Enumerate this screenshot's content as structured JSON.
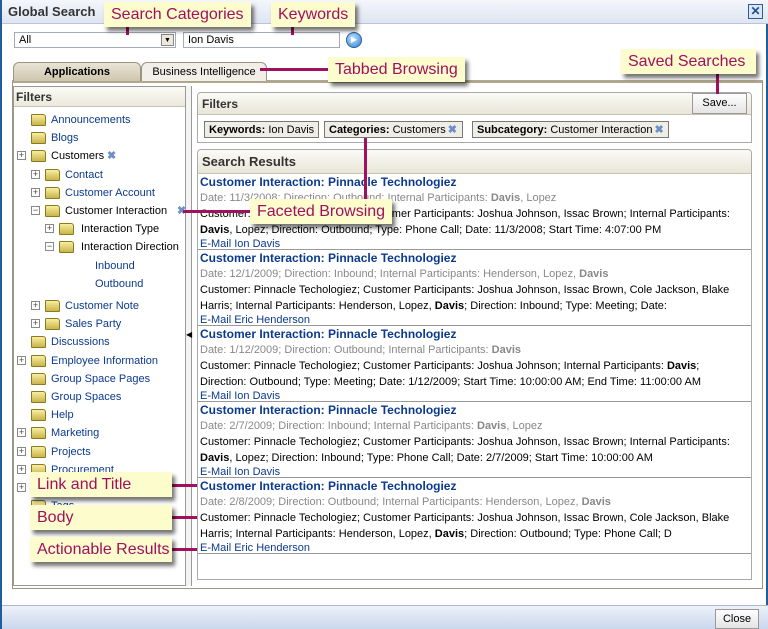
{
  "window": {
    "title": "Global Search",
    "close_icon": "close-icon"
  },
  "search": {
    "category": "All",
    "keywords": "Ion Davis",
    "go_icon": "go-arrow-icon"
  },
  "tabs": [
    {
      "label": "Applications",
      "selected": true
    },
    {
      "label": "Business Intelligence",
      "selected": false
    }
  ],
  "left_panel": {
    "title": "Filters",
    "tree": [
      {
        "label": "Announcements",
        "level": 0,
        "expander": "none",
        "link": true
      },
      {
        "label": "Blogs",
        "level": 0,
        "expander": "none",
        "link": true
      },
      {
        "label": "Customers",
        "level": 0,
        "expander": "plus",
        "link": false,
        "removable": true
      },
      {
        "label": "Contact",
        "level": 1,
        "expander": "plus",
        "link": true
      },
      {
        "label": "Customer Account",
        "level": 1,
        "expander": "plus",
        "link": true
      },
      {
        "label": "Customer Interaction",
        "level": 1,
        "expander": "minus",
        "link": false,
        "open": true,
        "removable": true
      },
      {
        "label": "Interaction Type",
        "level": 2,
        "expander": "plus",
        "link": false
      },
      {
        "label": "Interaction Direction",
        "level": 2,
        "expander": "minus",
        "link": false,
        "open": true
      },
      {
        "label": "Inbound",
        "level": 3,
        "expander": "leaf",
        "link": true
      },
      {
        "label": "Outbound",
        "level": 3,
        "expander": "leaf",
        "link": true
      },
      {
        "label": "Customer Note",
        "level": 1,
        "expander": "plus",
        "link": true,
        "gap": true
      },
      {
        "label": "Sales Party",
        "level": 1,
        "expander": "plus",
        "link": true
      },
      {
        "label": "Discussions",
        "level": 0,
        "expander": "none",
        "link": true
      },
      {
        "label": "Employee Information",
        "level": 0,
        "expander": "plus",
        "link": true
      },
      {
        "label": "Group Space Pages",
        "level": 0,
        "expander": "none",
        "link": true
      },
      {
        "label": "Group Spaces",
        "level": 0,
        "expander": "none",
        "link": true
      },
      {
        "label": "Help",
        "level": 0,
        "expander": "none",
        "link": true
      },
      {
        "label": "Marketing",
        "level": 0,
        "expander": "plus",
        "link": true
      },
      {
        "label": "Projects",
        "level": 0,
        "expander": "plus",
        "link": true
      },
      {
        "label": "Procurement",
        "level": 0,
        "expander": "plus",
        "link": true
      },
      {
        "label": "",
        "level": 0,
        "expander": "plus",
        "link": true
      },
      {
        "label": "Tags",
        "level": 0,
        "expander": "none",
        "link": true
      }
    ]
  },
  "filters": {
    "title": "Filters",
    "save_label": "Save...",
    "chips": [
      {
        "key": "Keywords:",
        "value": "Ion Davis",
        "removable": false
      },
      {
        "key": "Categories:",
        "value": "Customers",
        "removable": true
      },
      {
        "key": "Subcategory:",
        "value": "Customer Interaction",
        "removable": true
      }
    ]
  },
  "results": {
    "title": "Search Results",
    "items": [
      {
        "title": "Customer Interaction: Pinnacle Technologiez",
        "meta": [
          {
            "t": "Date: 11/3/2008; Direction: Outbound; Internal Participants: "
          },
          {
            "t": "Davis",
            "b": true
          },
          {
            "t": ", Lopez"
          }
        ],
        "body": [
          {
            "t": "Customer: Pinnacle Techologiez; Customer Participants: Joshua Johnson, Issac Brown; Internal Participants: "
          },
          {
            "t": "Davis",
            "b": true
          },
          {
            "t": ", Lopez; Direction: Outbound; Type: Phone Call; Date: 11/3/2008; Start Time: 4:07:00 PM"
          }
        ],
        "action": "E-Mail Ion Davis"
      },
      {
        "title": "Customer Interaction: Pinnacle Technologiez",
        "meta": [
          {
            "t": "Date: 12/1/2009; Direction: Inbound; Internal Participants: Henderson, Lopez, "
          },
          {
            "t": "Davis",
            "b": true
          }
        ],
        "body": [
          {
            "t": "Customer: Pinnacle Techologiez; Customer Participants: Joshua Johnson, Issac Brown, Cole Jackson, Blake Harris; Internal Participants: Henderson, Lopez, "
          },
          {
            "t": "Davis",
            "b": true
          },
          {
            "t": "; Direction: Inbound; Type: Meeting; Date:"
          }
        ],
        "action": "E-Mail Eric Henderson"
      },
      {
        "title": "Customer Interaction: Pinnacle Technologiez",
        "meta": [
          {
            "t": "Date: 1/12/2009; Direction: Outbound; Internal Participants: "
          },
          {
            "t": "Davis",
            "b": true
          }
        ],
        "body": [
          {
            "t": "Customer: Pinnacle Techologiez; Customer Participants: Joshua Johnson; Internal Participants: "
          },
          {
            "t": "Davis",
            "b": true
          },
          {
            "t": "; Direction: Outbound; Type: Meeting; Date: 1/12/2009; Start Time: 10:00:00 AM; End Time: 11:00:00 AM"
          }
        ],
        "action": "E-Mail Ion Davis"
      },
      {
        "title": "Customer Interaction: Pinnacle Technologiez",
        "meta": [
          {
            "t": "Date: 2/7/2009; Direction: Inbound; Internal Participants: "
          },
          {
            "t": "Davis",
            "b": true
          },
          {
            "t": ", Lopez"
          }
        ],
        "body": [
          {
            "t": "Customer: Pinnacle Techologiez; Customer Participants: Joshua Johnson, Issac Brown; Internal Participants: "
          },
          {
            "t": "Davis",
            "b": true
          },
          {
            "t": ", Lopez; Direction: Inbound; Type: Phone Call; Date: 2/7/2009; Start Time: 10:00:00 AM"
          }
        ],
        "action": "E-Mail Ion Davis"
      },
      {
        "title": "Customer Interaction: Pinnacle Technologiez",
        "meta": [
          {
            "t": "Date: 2/8/2009; Direction: Outbound; Internal Participants: Henderson, Lopez, "
          },
          {
            "t": "Davis",
            "b": true
          }
        ],
        "body": [
          {
            "t": "Customer: Pinnacle Techologiez; Customer Participants: Joshua Johnson, Issac Brown, Cole Jackson, Blake Harris; Internal Participants: Henderson, Lopez, "
          },
          {
            "t": "Davis",
            "b": true
          },
          {
            "t": "; Direction: Outbound; Type: Phone Call; D"
          }
        ],
        "action": "E-Mail Eric Henderson"
      }
    ]
  },
  "footer": {
    "close_label": "Close"
  },
  "callouts": {
    "search_categories": "Search Categories",
    "keywords": "Keywords",
    "tabbed_browsing": "Tabbed Browsing",
    "saved_searches": "Saved Searches",
    "faceted_browsing": "Faceted Browsing",
    "link_and_title": "Link and Title",
    "body": "Body",
    "actionable_results": "Actionable Results"
  },
  "colors": {
    "window_border": "#1f5d9c",
    "link": "#0b3a8d",
    "callout_bg": "#fdfccc",
    "callout_text": "#a0105e"
  }
}
